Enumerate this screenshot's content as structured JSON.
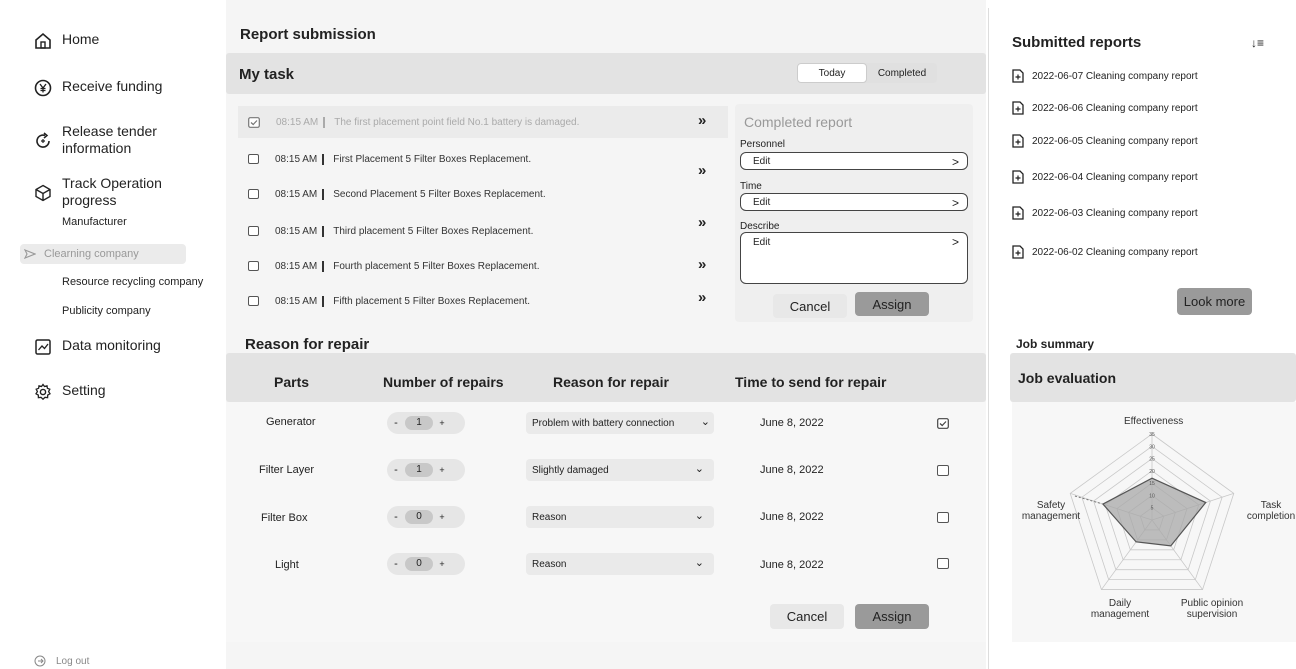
{
  "sidebar": {
    "items": [
      {
        "label": "Home",
        "icon": "home-icon"
      },
      {
        "label": "Receive funding",
        "icon": "yen-coin-icon"
      },
      {
        "label": "Release tender information",
        "icon": "refresh-arrow-icon"
      },
      {
        "label": "Track Operation progress",
        "icon": "cube-icon"
      },
      {
        "label": "Data monitoring",
        "icon": "chart-icon"
      },
      {
        "label": "Setting",
        "icon": "gear-icon"
      }
    ],
    "subitems": [
      "Manufacturer",
      "Clearning company",
      "Resource recycling company",
      "Publicity company"
    ],
    "logout": "Log out"
  },
  "main": {
    "title": "Report submission",
    "my_task": {
      "title": "My task",
      "toggle": [
        "Today",
        "Completed"
      ],
      "tasks": [
        {
          "time": "08:15 AM",
          "text": "The first placement point field No.1 battery is damaged."
        },
        {
          "time": "08:15 AM",
          "text": "First Placement 5 Filter Boxes Replacement."
        },
        {
          "time": "08:15 AM",
          "text": "Second Placement 5 Filter Boxes Replacement."
        },
        {
          "time": "08:15 AM",
          "text": "Third placement 5 Filter Boxes Replacement."
        },
        {
          "time": "08:15 AM",
          "text": "Fourth placement 5 Filter Boxes Replacement."
        },
        {
          "time": "08:15 AM",
          "text": "Fifth placement 5 Filter Boxes Replacement."
        }
      ],
      "arrow": "»",
      "completed": {
        "title": "Completed report",
        "personnel_label": "Personnel",
        "time_label": "Time",
        "describe_label": "Describe",
        "edit": "Edit",
        "cancel": "Cancel",
        "assign": "Assign"
      }
    },
    "repair": {
      "title": "Reason for repair",
      "headers": [
        "Parts",
        "Number of repairs",
        "Reason for repair",
        "Time to send for repair"
      ],
      "rows": [
        {
          "part": "Generator",
          "count": "1",
          "reason": "Problem with battery connection",
          "date": "June 8, 2022",
          "checked": true
        },
        {
          "part": "Filter Layer",
          "count": "1",
          "reason": "Slightly damaged",
          "date": "June 8, 2022",
          "checked": false
        },
        {
          "part": "Filter  Box",
          "count": "0",
          "reason": "Reason",
          "date": "June 8, 2022",
          "checked": false
        },
        {
          "part": "Light",
          "count": "0",
          "reason": "Reason",
          "date": "June 8, 2022",
          "checked": false
        }
      ],
      "cancel": "Cancel",
      "assign": "Assign"
    }
  },
  "right": {
    "title": "Submitted reports",
    "reports": [
      "2022-06-07 Cleaning company report",
      "2022-06-06 Cleaning company report",
      "2022-06-05 Cleaning company report",
      "2022-06-04 Cleaning company report",
      "2022-06-03 Cleaning company report",
      "2022-06-02 Cleaning company report"
    ],
    "look_more": "Look more",
    "job_summary": "Job summary",
    "job_evaluation": "Job evaluation"
  },
  "chart_data": {
    "type": "radar",
    "axes": [
      "Effectiveness",
      "Task completion",
      "Public opinion supervision",
      "Daily management",
      "Safety management"
    ],
    "tick_labels": [
      "5",
      "10",
      "15",
      "20",
      "25",
      "30",
      "35"
    ],
    "range": [
      0,
      35
    ],
    "values": [
      17,
      23,
      13,
      11,
      21
    ]
  }
}
